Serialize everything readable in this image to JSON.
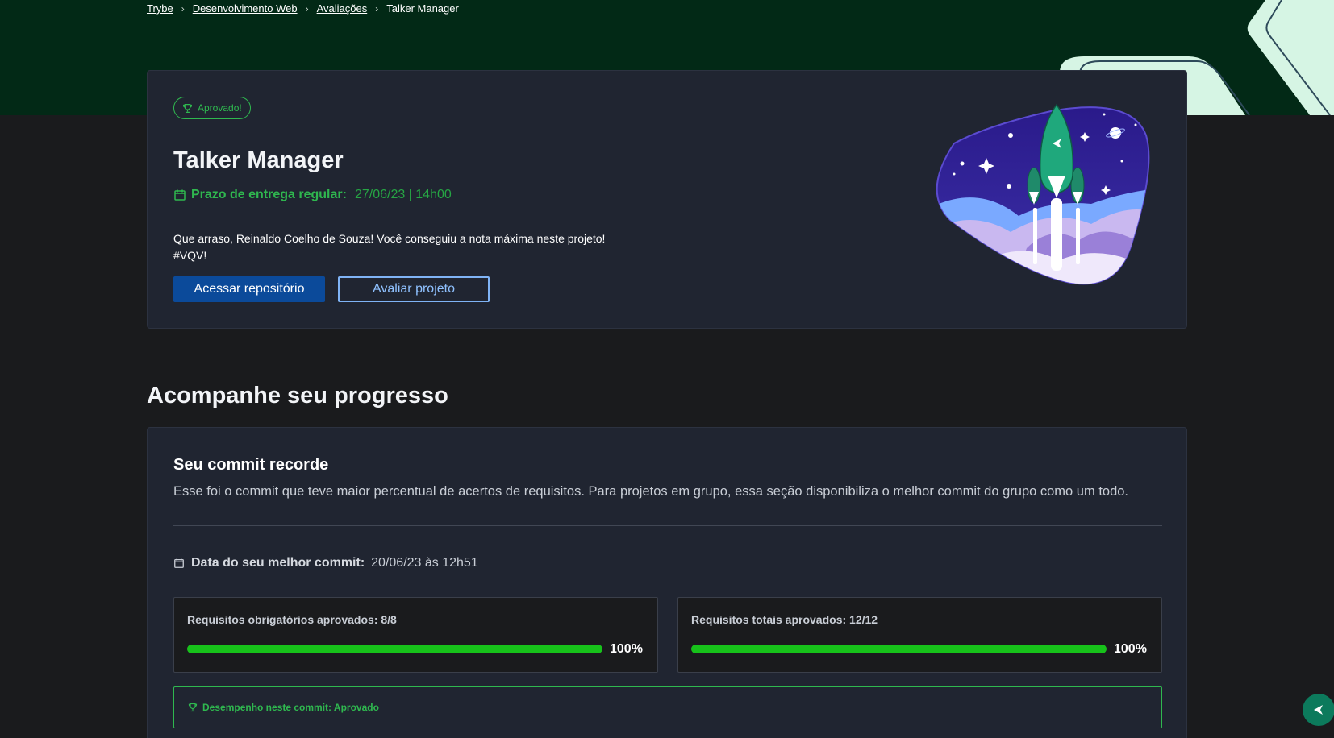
{
  "breadcrumb": {
    "items": [
      "Trybe",
      "Desenvolvimento Web",
      "Avaliações"
    ],
    "current": "Talker Manager"
  },
  "project": {
    "badge": "Aprovado!",
    "title": "Talker Manager",
    "deadline_label": "Prazo de entrega regular:",
    "deadline_value": "27/06/23 | 14h00",
    "message_line1": "Que arraso, Reinaldo Coelho de Souza! Você conseguiu a nota máxima neste projeto!",
    "message_line2": "#VQV!",
    "primary_button": "Acessar repositório",
    "secondary_button": "Avaliar projeto"
  },
  "progress": {
    "section_title": "Acompanhe seu progresso",
    "commit_title": "Seu commit recorde",
    "commit_desc": "Esse foi o commit que teve maior percentual de acertos de requisitos. Para projetos em grupo, essa seção disponibiliza o melhor commit do grupo como um todo.",
    "best_date_label": "Data do seu melhor commit:",
    "best_date_value": "20/06/23 às 12h51",
    "mandatory": {
      "label": "Requisitos obrigatórios aprovados: 8/8",
      "percent": 100,
      "percent_text": "100%"
    },
    "total": {
      "label": "Requisitos totais aprovados: 12/12",
      "percent": 100,
      "percent_text": "100%"
    },
    "performance": "Desempenho neste commit: Aprovado"
  },
  "colors": {
    "accent_green": "#2fb84f",
    "progress_green": "#17c21a",
    "primary_blue": "#0b4a9a",
    "hero_band": "#022916"
  },
  "icons": {
    "badge": "trophy-icon",
    "deadline": "calendar-icon",
    "best_date": "calendar-icon",
    "performance": "trophy-icon",
    "fab": "trybe-logo-icon"
  }
}
